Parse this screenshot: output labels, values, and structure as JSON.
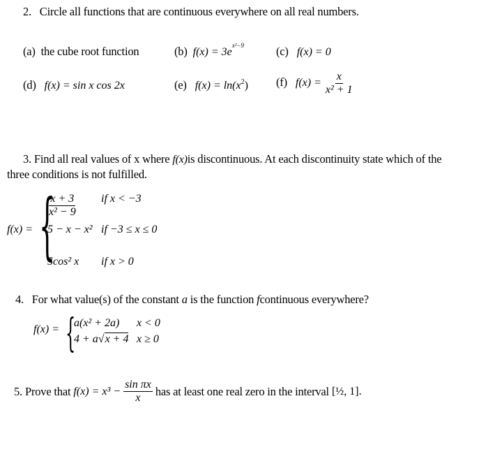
{
  "q2": {
    "number": "2.",
    "prompt": "Circle all functions that are continuous everywhere on all real numbers.",
    "options": [
      {
        "label": "(a)",
        "text": "the cube root function"
      },
      {
        "label": "(b)",
        "lhs": "f(x) = 3e",
        "exp": "x²−9"
      },
      {
        "label": "(c)",
        "lhs": "f(x) = 0"
      },
      {
        "label": "(d)",
        "lhs": "f(x) = sin x cos 2x"
      },
      {
        "label": "(e)",
        "lhs": "f(x) = ln(x",
        "exp": "2",
        "tail": ")"
      },
      {
        "label": "(f)",
        "lhs": "f(x) =",
        "num": "x",
        "den": "x² + 1"
      }
    ]
  },
  "q3": {
    "number": "3.",
    "prompt_a": "Find all real values of x where",
    "fx": "f(x)",
    "prompt_b": "is discontinuous.  At each discontinuity state which of the",
    "prompt_c": "three conditions is not fulfilled.",
    "lhs": "f(x) =",
    "pieces": [
      {
        "num": "x + 3",
        "den": "x² − 9",
        "cond": "if  x < −3"
      },
      {
        "expr": "5 − x − x²",
        "cond": "if  −3 ≤ x ≤ 0"
      },
      {
        "expr": "5cos² x",
        "cond": "if  x > 0"
      }
    ]
  },
  "q4": {
    "number": "4.",
    "prompt_a": "For what value(s) of the constant",
    "var_a": "a",
    "prompt_b": "is the function",
    "var_f": "f",
    "prompt_c": "continuous everywhere?",
    "lhs": "f(x) =",
    "pieces": [
      {
        "expr": "a(x² + 2a)",
        "cond": "x < 0"
      },
      {
        "expr_pre": "4 + a",
        "sqrt": "x + 4",
        "cond": "x ≥ 0"
      }
    ]
  },
  "q5": {
    "number": "5.",
    "prompt_a": "Prove that",
    "lhs": "f(x) = x³ −",
    "num": "sin πx",
    "den": "x",
    "prompt_b": "has at least one real zero in the interval",
    "interval": "[½, 1]."
  }
}
